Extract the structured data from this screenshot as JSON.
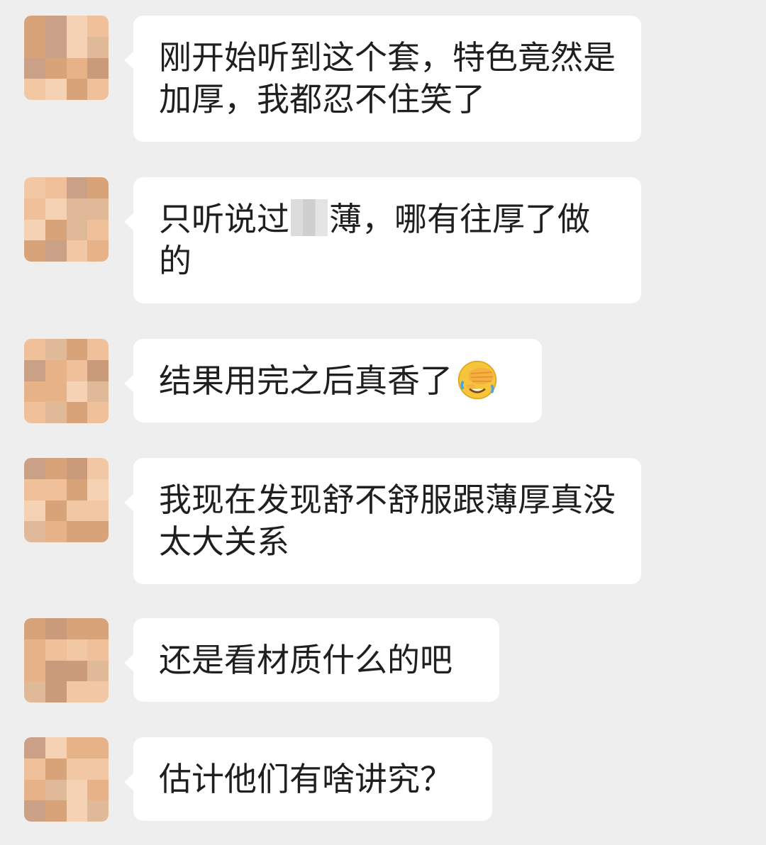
{
  "colors": {
    "background": "#eeeeee",
    "bubble": "#ffffff",
    "text": "#1f1f1f",
    "avatar_palette": [
      "#f5d2b3",
      "#efc09a",
      "#e8b288",
      "#d9a37a",
      "#caa186",
      "#f2c7a3",
      "#c99b7a",
      "#e0b998"
    ]
  },
  "messages": [
    {
      "text": "刚开始听到这个套，特色竟然是加厚，我都忍不住笑了",
      "avatar": "blurred-avatar"
    },
    {
      "text_before_mask": "只听说过",
      "text_after_mask": "薄，哪有往厚了做的",
      "avatar": "blurred-avatar"
    },
    {
      "text": "结果用完之后真香了",
      "emoji": "face-palm-emoji",
      "avatar": "blurred-avatar"
    },
    {
      "text": "我现在发现舒不舒服跟薄厚真没太大关系",
      "avatar": "blurred-avatar"
    },
    {
      "text": "还是看材质什么的吧",
      "avatar": "blurred-avatar"
    },
    {
      "text": "估计他们有啥讲究？",
      "avatar": "blurred-avatar"
    }
  ]
}
